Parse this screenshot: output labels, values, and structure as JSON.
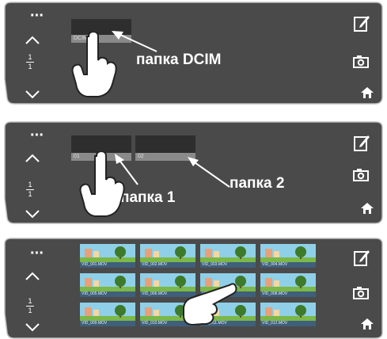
{
  "panels": [
    {
      "caption": "папка DCIM",
      "folders": [
        {
          "label": "DCIM"
        }
      ]
    },
    {
      "caption_left": "папка 1",
      "caption_right": "папка 2",
      "folders": [
        {
          "label": "01"
        },
        {
          "label": "02"
        }
      ]
    },
    {
      "thumbnails": [
        {
          "label": "VID_001.MOV"
        },
        {
          "label": "VID_002.MOV"
        },
        {
          "label": "VID_003.MOV"
        },
        {
          "label": "VID_004.MOV"
        },
        {
          "label": "VID_005.MOV"
        },
        {
          "label": "VID_006.MOV"
        },
        {
          "label": "VID_007.MOV"
        },
        {
          "label": "VID_008.MOV"
        },
        {
          "label": "VID_009.MOV"
        },
        {
          "label": "VID_010.MOV"
        },
        {
          "label": "VID_011.MOV"
        },
        {
          "label": "VID_012.MOV"
        }
      ]
    }
  ],
  "page_indicator": {
    "current": "1",
    "total": "1"
  },
  "colors": {
    "panel": "#4a4a4a",
    "folder": "#2e2e2e",
    "text": "#ffffff",
    "sky": "#8fd0e8",
    "grass": "#7ab848",
    "tree": "#3d7a2a"
  },
  "icons": [
    "more-icon",
    "chevron-up-icon",
    "chevron-down-icon",
    "edit-icon",
    "camera-icon",
    "home-icon",
    "hand-pointer-icon",
    "arrow-icon"
  ]
}
